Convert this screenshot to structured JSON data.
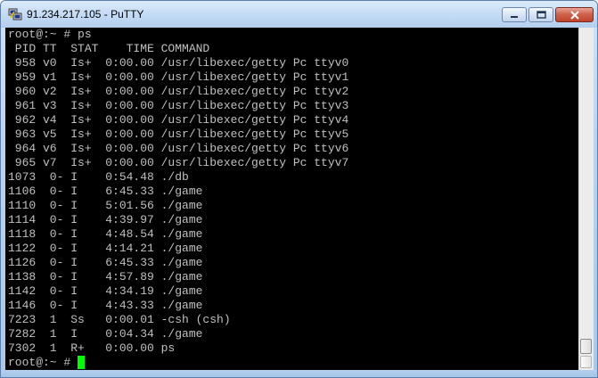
{
  "window": {
    "title": "91.234.217.105 - PuTTY",
    "app_icon": "putty-icon",
    "buttons": {
      "minimize_icon": "minimize-icon",
      "maximize_icon": "maximize-icon",
      "close_icon": "close-icon"
    }
  },
  "colors": {
    "terminal_bg": "#000000",
    "terminal_fg": "#c0c0c0",
    "cursor": "#00ff00"
  },
  "terminal": {
    "lines": [
      "root@:~ # ps",
      " PID TT  STAT    TIME COMMAND",
      " 958 v0  Is+  0:00.00 /usr/libexec/getty Pc ttyv0",
      " 959 v1  Is+  0:00.00 /usr/libexec/getty Pc ttyv1",
      " 960 v2  Is+  0:00.00 /usr/libexec/getty Pc ttyv2",
      " 961 v3  Is+  0:00.00 /usr/libexec/getty Pc ttyv3",
      " 962 v4  Is+  0:00.00 /usr/libexec/getty Pc ttyv4",
      " 963 v5  Is+  0:00.00 /usr/libexec/getty Pc ttyv5",
      " 964 v6  Is+  0:00.00 /usr/libexec/getty Pc ttyv6",
      " 965 v7  Is+  0:00.00 /usr/libexec/getty Pc ttyv7",
      "1073  0- I    0:54.48 ./db",
      "1106  0- I    6:45.33 ./game",
      "1110  0- I    5:01.56 ./game",
      "1114  0- I    4:39.97 ./game",
      "1118  0- I    4:48.54 ./game",
      "1122  0- I    4:14.21 ./game",
      "1126  0- I    6:45.33 ./game",
      "1138  0- I    4:57.89 ./game",
      "1142  0- I    4:34.19 ./game",
      "1146  0- I    4:43.33 ./game",
      "7223  1  Ss   0:00.01 -csh (csh)",
      "7282  1  I    0:04.34 ./game",
      "7302  1  R+   0:00.00 ps"
    ],
    "prompt": "root@:~ # "
  }
}
